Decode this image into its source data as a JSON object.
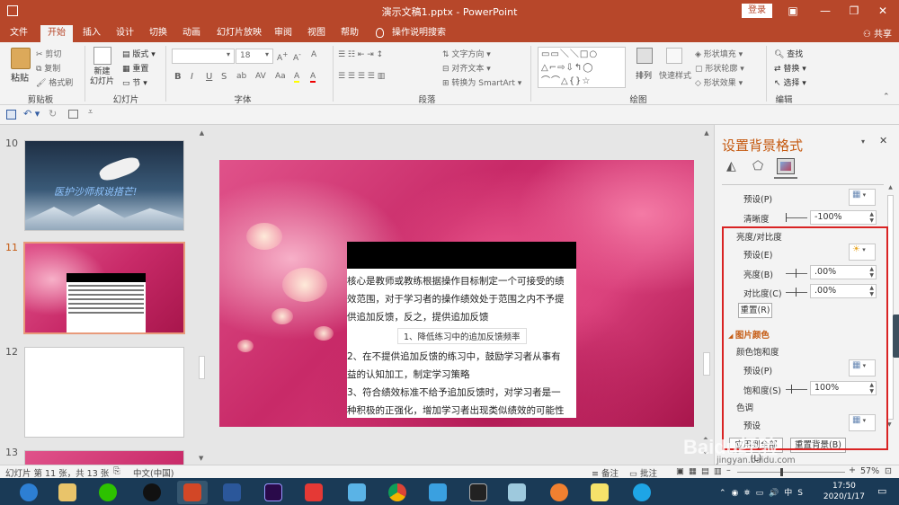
{
  "window": {
    "title": "演示文稿1.pptx  -  PowerPoint",
    "login": "登录"
  },
  "tabs": [
    "文件",
    "开始",
    "插入",
    "设计",
    "切换",
    "动画",
    "幻灯片放映",
    "审阅",
    "视图",
    "帮助",
    "操作说明搜索"
  ],
  "share": "共享",
  "ribbon": {
    "clipboard": {
      "paste": "粘贴",
      "cut": "剪切",
      "copy": "复制",
      "painter": "格式刷",
      "label": "剪贴板"
    },
    "slides": {
      "new_slide": "新建\n幻灯片",
      "layout": "版式",
      "reset": "重置",
      "section": "节",
      "label": "幻灯片"
    },
    "font": {
      "size": "18",
      "label": "字体",
      "buttons": [
        "B",
        "I",
        "U",
        "S",
        "ab",
        "AV",
        "Aa",
        "A",
        "A"
      ]
    },
    "paragraph": {
      "text_dir": "文字方向",
      "align_text": "对齐文本",
      "smartart": "转换为 SmartArt",
      "label": "段落"
    },
    "drawing": {
      "arrange": "排列",
      "quick_styles": "快速样式",
      "fill": "形状填充",
      "outline": "形状轮廓",
      "effects": "形状效果",
      "label": "绘图"
    },
    "editing": {
      "find": "查找",
      "replace": "替换",
      "select": "选择",
      "label": "编辑"
    }
  },
  "thumbnails": {
    "numbers": [
      "10",
      "11",
      "12",
      "13"
    ],
    "slide10_text": "医护沙师叔说搭芒!",
    "selected": "11"
  },
  "slide": {
    "lines": [
      "核心是教师或教练根据操作目标制定一个可接受的绩",
      "效范围，对于学习者的操作绩效处于范围之内不予提",
      "供追加反馈，反之，提供追加反馈"
    ],
    "sublabel": "1、降低练习中的追加反馈频率",
    "lines2": [
      "2、在不提供追加反馈的练习中，鼓励学习者从事有",
      "益的认知加工，制定学习策略",
      "3、符合绩效标准不给予追加反馈时，对学习者是一",
      "种积极的正强化，增加学习者出现类似绩效的可能性"
    ]
  },
  "pane": {
    "title": "设置背景格式",
    "preset1": "预设(P)",
    "sharpness": {
      "label": "清晰度",
      "value": "-100%"
    },
    "brightness_contrast": "亮度/对比度",
    "preset2": "预设(E)",
    "brightness": {
      "label": "亮度(B)",
      "value": ".00%"
    },
    "contrast": {
      "label": "对比度(C)",
      "value": ".00%"
    },
    "reset": "重置(R)",
    "picture_color": "图片颜色",
    "saturation_section": "颜色饱和度",
    "preset3": "预设(P)",
    "saturation": {
      "label": "饱和度(S)",
      "value": "100%"
    },
    "tone": "色调",
    "preset4": "预设",
    "apply_all": "应用到全部(L)",
    "reset_bg": "重置背景(B)"
  },
  "status": {
    "slide_info": "幻灯片 第 11 张，共 13 张",
    "language": "中文(中国)",
    "notes": "备注",
    "comments": "批注",
    "zoom": "57%"
  },
  "taskbar": {
    "time": "17:50",
    "date": "2020/1/17"
  },
  "watermark": "Baidu经验",
  "watermark_url": "jingyan.baidu.com"
}
